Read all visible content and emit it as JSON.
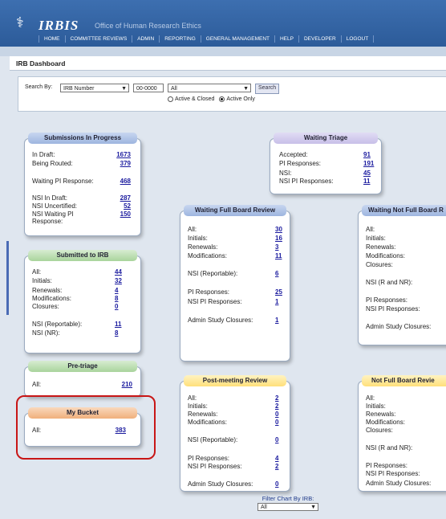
{
  "app": {
    "name": "IRBIS",
    "subtitle": "Office of Human Research Ethics"
  },
  "nav": [
    "HOME",
    "COMMITTEE REVIEWS",
    "ADMIN",
    "REPORTING",
    "GENERAL MANAGEMENT",
    "HELP",
    "DEVELOPER",
    "LOGOUT"
  ],
  "page_title": "IRB Dashboard",
  "search": {
    "label": "Search By:",
    "field_value": "IRB Number",
    "number_value": "00-0000",
    "scope_value": "All",
    "button": "Search",
    "radio_all": "Active & Closed",
    "radio_active": "Active Only"
  },
  "panels": {
    "submissions": {
      "title": "Submissions In Progress",
      "rows": [
        {
          "label": "In Draft:",
          "value": "1673"
        },
        {
          "label": "Being Routed:",
          "value": "379"
        },
        {
          "label": "Waiting PI Response:",
          "value": "468"
        },
        {
          "label": "NSI In Draft:",
          "value": "287"
        },
        {
          "label": "NSI Uncertified:",
          "value": "52"
        },
        {
          "label": "NSI Waiting PI",
          "label2": "Response:",
          "value": "150"
        }
      ]
    },
    "submitted": {
      "title": "Submitted to IRB",
      "rows": [
        {
          "label": "All:",
          "value": "44"
        },
        {
          "label": "Initials:",
          "value": "32"
        },
        {
          "label": "Renewals:",
          "value": "4"
        },
        {
          "label": "Modifications:",
          "value": "8"
        },
        {
          "label": "Closures:",
          "value": "0"
        },
        {
          "label": "NSI (Reportable):",
          "value": "11"
        },
        {
          "label": "NSI (NR):",
          "value": "8"
        }
      ]
    },
    "pretriage": {
      "title": "Pre-triage",
      "rows": [
        {
          "label": "All:",
          "value": "210"
        }
      ]
    },
    "mybucket": {
      "title": "My Bucket",
      "rows": [
        {
          "label": "All:",
          "value": "383"
        }
      ]
    },
    "triage": {
      "title": "Waiting Triage",
      "rows": [
        {
          "label": "Accepted:",
          "value": "91"
        },
        {
          "label": "PI Responses:",
          "value": "191"
        },
        {
          "label": "NSI:",
          "value": "45"
        },
        {
          "label": "NSI PI Responses:",
          "value": "11"
        }
      ]
    },
    "fullboard": {
      "title": "Waiting Full Board Review",
      "rows": [
        {
          "label": "All:",
          "value": "30"
        },
        {
          "label": "Initials:",
          "value": "16"
        },
        {
          "label": "Renewals:",
          "value": "3"
        },
        {
          "label": "Modifications:",
          "value": "11"
        },
        {
          "label": "NSI (Reportable):",
          "value": "6"
        },
        {
          "label": "PI Responses:",
          "value": "25"
        },
        {
          "label": "NSI PI Responses:",
          "value": "1"
        },
        {
          "label": "Admin Study Closures:",
          "value": "1"
        }
      ]
    },
    "postmeeting": {
      "title": "Post-meeting Review",
      "rows": [
        {
          "label": "All:",
          "value": "2"
        },
        {
          "label": "Initials:",
          "value": "2"
        },
        {
          "label": "Renewals:",
          "value": "0"
        },
        {
          "label": "Modifications:",
          "value": "0"
        },
        {
          "label": "NSI (Reportable):",
          "value": "0"
        },
        {
          "label": "PI Responses:",
          "value": "4"
        },
        {
          "label": "NSI PI Responses:",
          "value": "2"
        },
        {
          "label": "Admin Study Closures:",
          "value": "0"
        }
      ]
    },
    "notfullboard_wait": {
      "title": "Waiting Not Full Board R",
      "rows": [
        {
          "label": "All:"
        },
        {
          "label": "Initials:"
        },
        {
          "label": "Renewals:"
        },
        {
          "label": "Modifications:"
        },
        {
          "label": "Closures:"
        },
        {
          "label": "NSI (R and NR):"
        },
        {
          "label": "PI Responses:"
        },
        {
          "label": "NSI PI Responses:"
        },
        {
          "label": "Admin Study Closures:"
        }
      ]
    },
    "notfullboard": {
      "title": "Not Full Board Revie",
      "rows": [
        {
          "label": "All:"
        },
        {
          "label": "Initials:"
        },
        {
          "label": "Renewals:"
        },
        {
          "label": "Modifications:"
        },
        {
          "label": "Closures:"
        },
        {
          "label": "NSI (R and NR):"
        },
        {
          "label": "PI Responses:"
        },
        {
          "label": "NSI PI Responses:"
        },
        {
          "label": "Admin Study Closures:"
        }
      ]
    }
  },
  "filter": {
    "label": "Filter Chart By IRB:",
    "value": "All"
  },
  "colors": {
    "header": "#2c5b99",
    "link": "#1a1a9e",
    "highlight": "#c81616"
  }
}
